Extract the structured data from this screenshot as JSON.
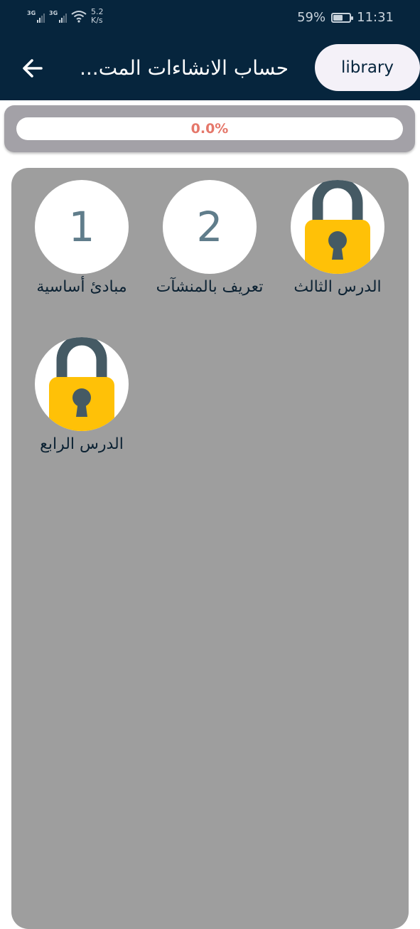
{
  "status_bar": {
    "net1": "3G",
    "net2": "3G",
    "speed_value": "5.2",
    "speed_unit": "K/s",
    "battery": "59%",
    "battery_level": 0.59,
    "time": "11:31"
  },
  "app_bar": {
    "title": "...حساب الانشاءات المت",
    "library_label": "library"
  },
  "progress": {
    "text": "0.0%",
    "value": 0.0
  },
  "lessons": [
    {
      "number": "1",
      "label": "مبادئ أساسية",
      "locked": false
    },
    {
      "number": "2",
      "label": "تعريف بالمنشآت",
      "locked": false
    },
    {
      "number": "",
      "label": "الدرس الثالث",
      "locked": true
    },
    {
      "number": "",
      "label": "الدرس الرابع",
      "locked": true
    }
  ],
  "colors": {
    "header": "#06253d",
    "library_button": "#f4f1f8",
    "progress": "#e5776a",
    "panel": "#9e9e9e",
    "number": "#607d8b",
    "lock_body": "#ffc107",
    "lock_shackle": "#455a64"
  }
}
